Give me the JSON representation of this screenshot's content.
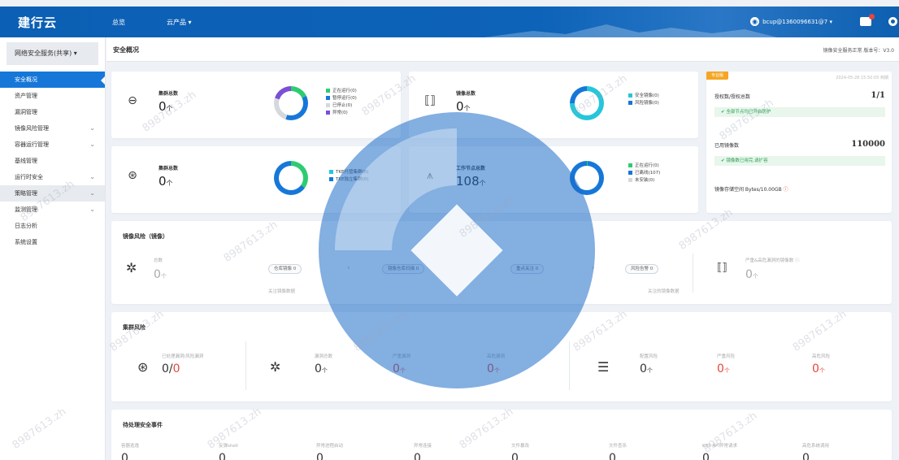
{
  "app": {
    "logo": "建行云"
  },
  "topnav": {
    "item1": "总览",
    "item2": "云产品 ▾"
  },
  "user": {
    "name": "bcup@1360096631@7 ▾"
  },
  "sidebar": {
    "service": "网络安全服务(共享) ▾",
    "items": [
      {
        "label": "安全概况",
        "active": true
      },
      {
        "label": "资产管理"
      },
      {
        "label": "漏洞管理"
      },
      {
        "label": "镜像风险管理",
        "chevron": "⌄"
      },
      {
        "label": "容器运行管理",
        "chevron": "⌄"
      },
      {
        "label": "基线管理"
      },
      {
        "label": "运行时安全",
        "chevron": "⌄"
      },
      {
        "label": "策略管理",
        "chevron": "⌄",
        "highlight": true
      },
      {
        "label": "监测管理",
        "chevron": "⌄"
      },
      {
        "label": "日志分析"
      },
      {
        "label": "系统设置"
      }
    ]
  },
  "breadcrumb": {
    "title": "安全概况",
    "right": "镜像安全服务正常 版本号：V3.0"
  },
  "cards": {
    "nodes": {
      "label": "集群总数",
      "value": "0",
      "unit": "个",
      "legend": [
        {
          "label": "正在运行(0)",
          "color": "#2ecc71"
        },
        {
          "label": "暂停运行(0)",
          "color": "#1677d9"
        },
        {
          "label": "已停止(0)",
          "color": "#d5d8dd"
        },
        {
          "label": "异常(0)",
          "color": "#7b4fd6"
        }
      ]
    },
    "mirror": {
      "label": "镜像总数",
      "value": "0",
      "unit": "个",
      "legend": [
        {
          "label": "安全镜像(0)",
          "color": "#26c6da"
        },
        {
          "label": "风险镜像(0)",
          "color": "#1677d9"
        }
      ]
    },
    "cluster": {
      "label": "集群总数",
      "value": "0",
      "unit": "个",
      "legend": [
        {
          "label": "TKE托管集群(0)",
          "color": "#26c6da"
        },
        {
          "label": "TKE独立集群(0)",
          "color": "#1677d9"
        }
      ]
    },
    "host": {
      "label": "工作节点总数",
      "value": "108",
      "unit": "个",
      "legend": [
        {
          "label": "正在运行(0)",
          "color": "#2ecc71"
        },
        {
          "label": "已离线(107)",
          "color": "#1677d9"
        },
        {
          "label": "未安装(0)",
          "color": "#d5d8dd"
        }
      ]
    }
  },
  "license": {
    "badge": "专业版",
    "time": "2024-05-28 15:50:05 到期",
    "row1": "授权数/授权总数",
    "row1_val": "1/1",
    "ok1": "全部节点均已开启防护",
    "row2": "已用镜像数",
    "row2_val": "110000",
    "ok2": "镜像数已用完,请扩容",
    "row3": "镜像存储空间 Bytes/10.00GB"
  },
  "mirror_risk": {
    "title": "镜像风险（镜像）",
    "total_label": "总数",
    "total_value": "0",
    "total_unit": "个",
    "flow": [
      "仓库镜像 0",
      "镜像仓库扫描 0",
      "重点关注 0",
      "风险告警 0"
    ],
    "note_left": "关注镜像数据",
    "note_right": "关注的镜像数据",
    "right_label": "严重&高危漏洞的镜像数 ⓘ",
    "right_value": "0",
    "right_unit": "个"
  },
  "cluster_risk": {
    "title": "集群风险",
    "a_label": "已处理漏洞/风险漏洞",
    "a_value": "0",
    "a_sep": "/",
    "a_value2": "0",
    "b1_label": "漏洞总数",
    "b1_value": "0",
    "b2_label": "严重漏洞",
    "b2_value": "0",
    "b3_label": "高危漏洞",
    "b3_value": "0",
    "c1_label": "配置风险",
    "c1_value": "0",
    "c2_label": "严重风险",
    "c2_value": "0",
    "c3_label": "高危风险",
    "c3_value": "0",
    "unit": "个"
  },
  "events": {
    "title": "待处理安全事件",
    "cols": [
      {
        "label": "容器逃逸",
        "value": "0"
      },
      {
        "label": "反弹shell",
        "value": "0"
      },
      {
        "label": "异常进程启动",
        "value": "0"
      },
      {
        "label": "异常连接",
        "value": "0"
      },
      {
        "label": "文件篡改",
        "value": "0"
      },
      {
        "label": "文件查杀",
        "value": "0"
      },
      {
        "label": "K8S API异常请求",
        "value": "0"
      },
      {
        "label": "高危系统调用",
        "value": "0"
      }
    ]
  },
  "watermark": "8987613.zh"
}
